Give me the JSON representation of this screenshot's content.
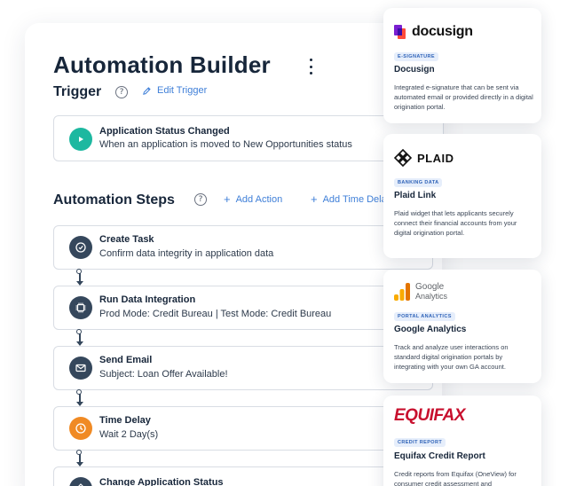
{
  "page": {
    "title": "Automation Builder",
    "trigger_label": "Trigger",
    "edit_trigger": "Edit Trigger",
    "help_glyph": "?",
    "steps_label": "Automation Steps",
    "add_action": "Add Action",
    "add_time_delay": "Add Time Delay"
  },
  "trigger": {
    "title": "Application Status Changed",
    "subtitle": "When an application is moved to New Opportunities status",
    "color": "#1db8a0"
  },
  "steps": [
    {
      "title": "Create Task",
      "subtitle": "Confirm data integrity in application data",
      "icon": "clock-check-icon",
      "color": "#35475c"
    },
    {
      "title": "Run Data Integration",
      "subtitle": "Prod Mode: Credit Bureau | Test Mode: Credit Bureau",
      "icon": "chip-icon",
      "color": "#35475c"
    },
    {
      "title": "Send Email",
      "subtitle": "Subject: Loan Offer Available!",
      "icon": "envelope-icon",
      "color": "#35475c"
    },
    {
      "title": "Time Delay",
      "subtitle": "Wait 2 Day(s)",
      "icon": "timer-icon",
      "color": "#f08a24"
    },
    {
      "title": "Change Application Status",
      "subtitle": "",
      "icon": "status-icon",
      "color": "#35475c"
    }
  ],
  "integrations": [
    {
      "logo": "docusign",
      "badge": "E-SIGNATURE",
      "title": "Docusign",
      "desc": "Integrated e-signature that can be sent via automated email or provided directly in a digital origination portal."
    },
    {
      "logo": "PLAID",
      "badge": "BANKING DATA",
      "title": "Plaid Link",
      "desc": "Plaid widget that lets applicants securely connect their financial accounts from your digital origination portal."
    },
    {
      "logo": "Google",
      "logo_sub": "Analytics",
      "badge": "PORTAL ANALYTICS",
      "title": "Google Analytics",
      "desc": "Track and analyze user interactions on standard digital origination portals by integrating with your own GA account."
    },
    {
      "logo": "EQUIFAX",
      "badge": "CREDIT REPORT",
      "title": "Equifax Credit Report",
      "desc": "Credit reports from Equifax (OneView) for consumer credit assessment and"
    }
  ]
}
